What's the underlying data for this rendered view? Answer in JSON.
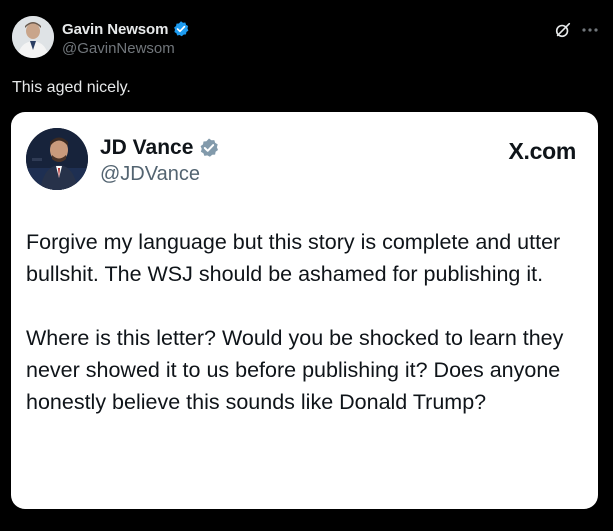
{
  "post": {
    "author": {
      "name": "Gavin Newsom",
      "handle": "@GavinNewsom",
      "verified_icon": "verified-badge-icon"
    },
    "actions": {
      "grok_icon": "grok-icon",
      "more_icon": "more-options-icon"
    },
    "text": "This aged nicely."
  },
  "quoted_card": {
    "author": {
      "name": "JD Vance",
      "handle": "@JDVance",
      "verified_icon": "verified-badge-grey-icon"
    },
    "source": "X.com",
    "paragraphs": [
      "Forgive my language but this story is complete and utter bullshit. The WSJ should be ashamed for publishing it.",
      "Where is this letter? Would you be shocked to learn they never showed it to us before publishing it? Does anyone honestly believe this sounds like Donald Trump?"
    ]
  },
  "colors": {
    "background": "#000000",
    "primary_text": "#e7e9ea",
    "secondary_text": "#71767b",
    "verified_blue": "#1d9bf0",
    "card_background": "#ffffff",
    "card_text": "#0f1419",
    "card_secondary_text": "#536471"
  }
}
